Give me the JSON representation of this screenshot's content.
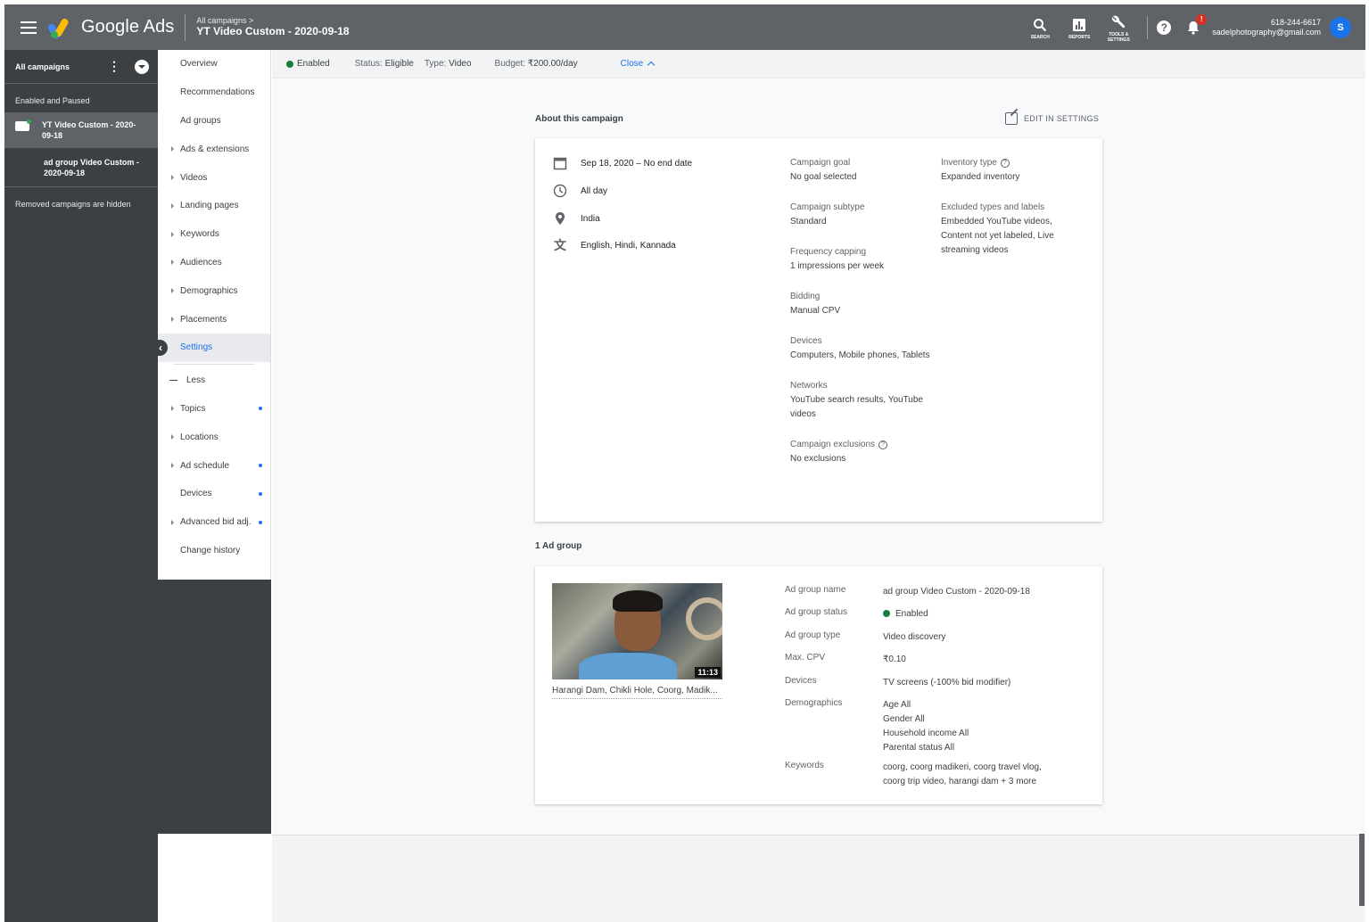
{
  "header": {
    "brand": "Google Ads",
    "breadcrumb_parent": "All campaigns  >",
    "breadcrumb_title": "YT Video Custom - 2020-09-18",
    "tools": [
      {
        "label": "SEARCH",
        "icon": "search-icon"
      },
      {
        "label": "REPORTS",
        "icon": "reports-icon"
      },
      {
        "label": "TOOLS & SETTINGS",
        "icon": "wrench-icon"
      }
    ],
    "help": "?",
    "notification_badge": "!",
    "account_id": "618-244-6617",
    "account_email": "sadelphotography@gmail.com",
    "avatar_letter": "S"
  },
  "darknav": {
    "title": "All campaigns",
    "filter_label": "Enabled and Paused",
    "campaign": "YT Video Custom - 2020-09-18",
    "adgroup": "ad group Video Custom - 2020-09-18",
    "removed_note": "Removed campaigns are hidden"
  },
  "pagemenu": {
    "items": [
      {
        "label": "Overview",
        "expand": false,
        "dot": false
      },
      {
        "label": "Recommendations",
        "expand": false,
        "dot": false
      },
      {
        "label": "Ad groups",
        "expand": false,
        "dot": false
      },
      {
        "label": "Ads & extensions",
        "expand": true,
        "dot": false
      },
      {
        "label": "Videos",
        "expand": true,
        "dot": false
      },
      {
        "label": "Landing pages",
        "expand": true,
        "dot": false
      },
      {
        "label": "Keywords",
        "expand": true,
        "dot": false
      },
      {
        "label": "Audiences",
        "expand": true,
        "dot": false
      },
      {
        "label": "Demographics",
        "expand": true,
        "dot": false
      },
      {
        "label": "Placements",
        "expand": true,
        "dot": false
      },
      {
        "label": "Settings",
        "expand": false,
        "dot": false,
        "active": true
      }
    ],
    "less_label": "Less",
    "more_items": [
      {
        "label": "Topics",
        "expand": true,
        "dot": true
      },
      {
        "label": "Locations",
        "expand": true,
        "dot": false
      },
      {
        "label": "Ad schedule",
        "expand": true,
        "dot": true
      },
      {
        "label": "Devices",
        "expand": false,
        "dot": true
      },
      {
        "label": "Advanced bid adj.",
        "expand": true,
        "dot": true
      },
      {
        "label": "Change history",
        "expand": false,
        "dot": false
      }
    ]
  },
  "statusbar": {
    "enabled": "Enabled",
    "status_label": "Status:",
    "status_value": "Eligible",
    "type_label": "Type:",
    "type_value": "Video",
    "budget_label": "Budget:",
    "budget_value": "₹200.00/day",
    "close": "Close"
  },
  "about": {
    "title": "About this campaign",
    "edit": "EDIT IN SETTINGS",
    "dates": "Sep 18, 2020 – No end date",
    "schedule": "All day",
    "location": "India",
    "languages": "English, Hindi, Kannada",
    "col2": [
      {
        "k": "Campaign goal",
        "v": "No goal selected"
      },
      {
        "k": "Campaign subtype",
        "v": "Standard"
      },
      {
        "k": "Frequency capping",
        "v": "1 impressions per week"
      },
      {
        "k": "Bidding",
        "v": "Manual CPV"
      },
      {
        "k": "Devices",
        "v": "Computers, Mobile phones, Tablets"
      },
      {
        "k": "Networks",
        "v": "YouTube search results, YouTube videos"
      },
      {
        "k": "Campaign exclusions",
        "v": "No exclusions",
        "help": true
      }
    ],
    "col3": [
      {
        "k": "Inventory type",
        "v": "Expanded inventory",
        "help": true
      },
      {
        "k": "Excluded types and labels",
        "v": "Embedded YouTube videos, Content not yet labeled, Live streaming videos"
      }
    ]
  },
  "adgroup": {
    "title": "1 Ad group",
    "video_duration": "11:13",
    "video_title": "Harangi Dam, Chikli Hole, Coorg, Madik...",
    "name_label": "Ad group name",
    "name_value": "ad group Video Custom - 2020-09-18",
    "status_label": "Ad group status",
    "status_value": "Enabled",
    "type_label": "Ad group type",
    "type_value": "Video discovery",
    "cpv_label": "Max. CPV",
    "cpv_value": "₹0.10",
    "devices_label": "Devices",
    "devices_value": "TV screens (-100% bid modifier)",
    "demo_label": "Demographics",
    "demo_lines": [
      "Age  All",
      "Gender  All",
      "Household income  All",
      "Parental status  All"
    ],
    "kw_label": "Keywords",
    "kw_value": "coorg, coorg madikeri, coorg travel vlog, coorg trip video, harangi dam + 3 more"
  }
}
